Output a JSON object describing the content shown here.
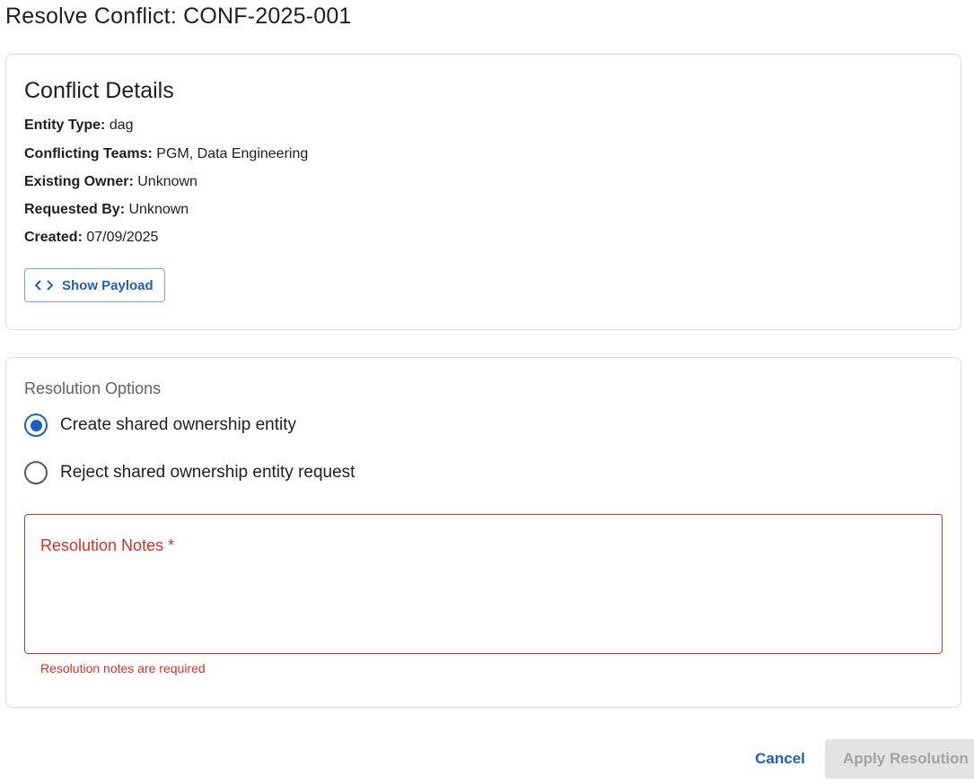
{
  "dialog": {
    "title": "Resolve Conflict: CONF-2025-001"
  },
  "details": {
    "heading": "Conflict Details",
    "rows": [
      {
        "key": "Entity Type:",
        "value": "dag"
      },
      {
        "key": "Conflicting Teams:",
        "value": "PGM, Data Engineering"
      },
      {
        "key": "Existing Owner:",
        "value": "Unknown"
      },
      {
        "key": "Requested By:",
        "value": "Unknown"
      },
      {
        "key": "Created:",
        "value": "07/09/2025"
      }
    ],
    "show_payload_label": "Show Payload",
    "show_payload_icon": "code-icon"
  },
  "resolution": {
    "options_label": "Resolution Options",
    "options": [
      {
        "label": "Create shared ownership entity",
        "selected": true
      },
      {
        "label": "Reject shared ownership entity request",
        "selected": false
      }
    ],
    "notes_label": "Resolution Notes *",
    "notes_value": "",
    "notes_error": "Resolution notes are required"
  },
  "actions": {
    "cancel_label": "Cancel",
    "apply_label": "Apply Resolution",
    "apply_disabled": true
  },
  "colors": {
    "accent": "#1f5fbf",
    "error": "#d93025",
    "disabled_bg": "#e3e3e3",
    "disabled_text": "#a3a3a3"
  }
}
